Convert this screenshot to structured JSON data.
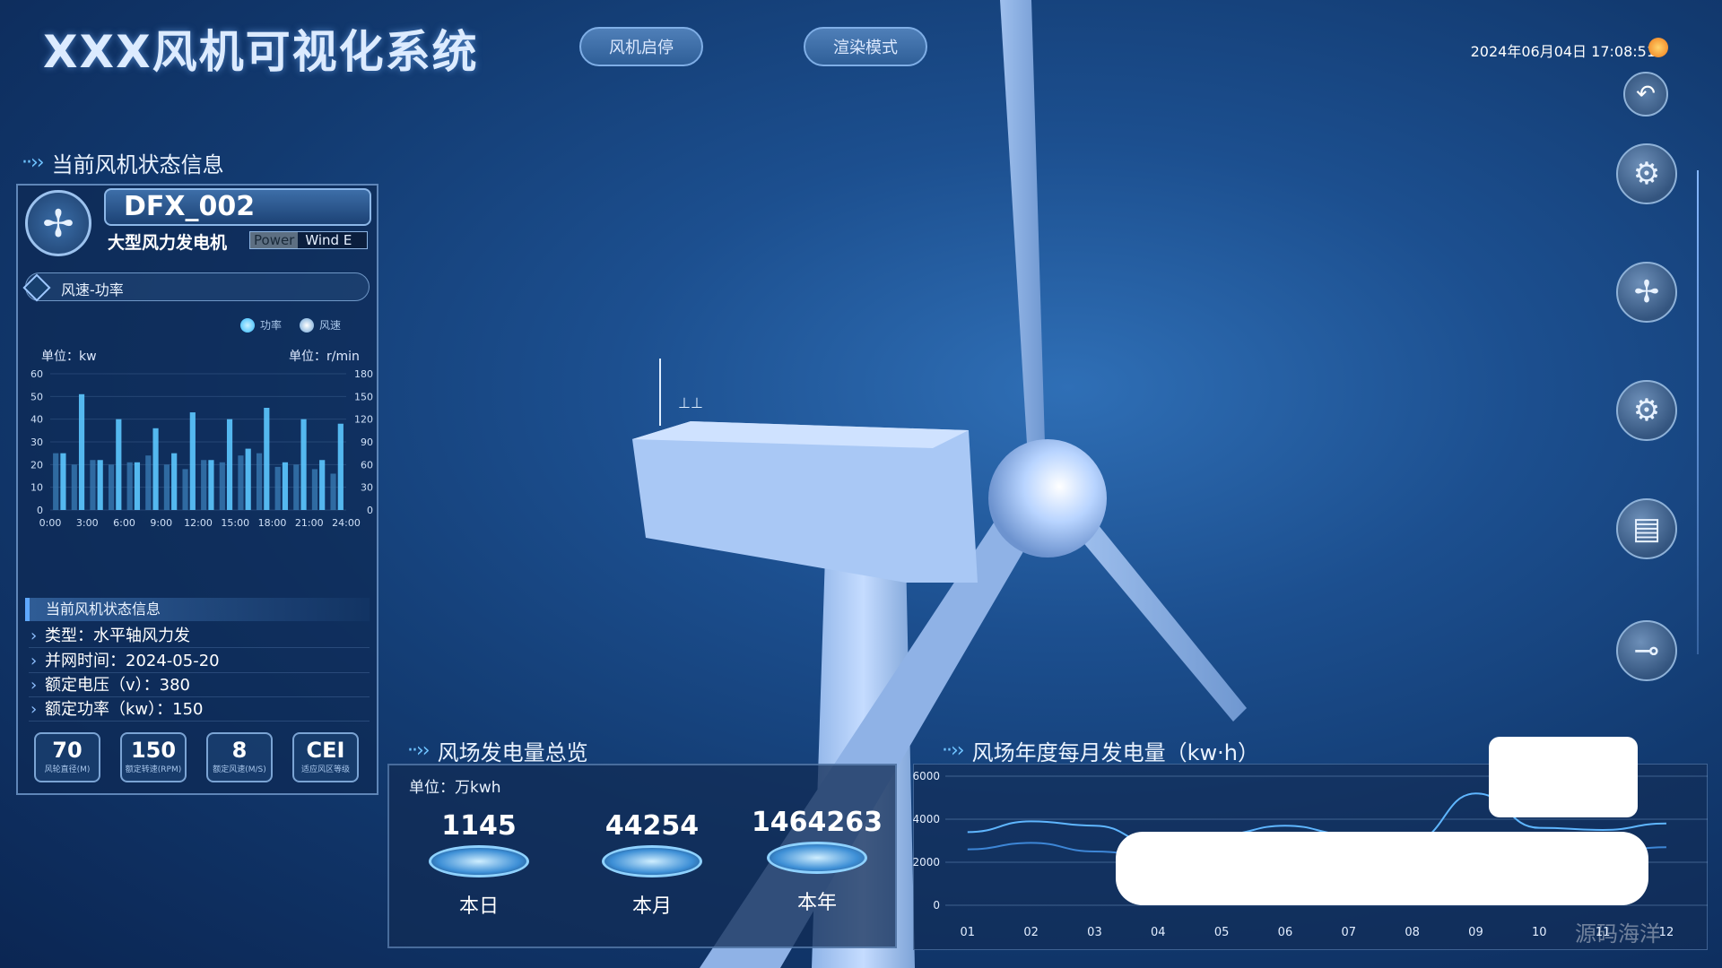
{
  "app": {
    "title": "XXX风机可视化系统",
    "buttons": [
      "风机启停",
      "渲染模式"
    ],
    "datetime": "2024年06月04日 17:08:51"
  },
  "status_section": {
    "title": "当前风机状态信息",
    "turbine_id": "DFX_002",
    "turbine_type": "大型风力发电机",
    "tag_power": "Power",
    "tag_wind": "Wind E",
    "chart_title": "风速-功率",
    "legend": [
      "功率",
      "风速"
    ],
    "unit_left": "单位：kw",
    "unit_right": "单位：r/min",
    "info_header": "当前风机状态信息",
    "info_rows": [
      "类型：水平轴风力发",
      "并网时间：2024-05-20",
      "额定电压（v）：380",
      "额定功率（kw）：150"
    ],
    "stats": [
      {
        "value": "70",
        "label": "风轮直径(M)"
      },
      {
        "value": "150",
        "label": "额定转速(RPM)"
      },
      {
        "value": "8",
        "label": "额定风速(M/S)"
      },
      {
        "value": "CEI",
        "label": "适应风区等级"
      }
    ]
  },
  "energy_section": {
    "title": "风场发电量总览",
    "unit": "单位：万kwh",
    "items": [
      {
        "value": "1145",
        "label": "本日"
      },
      {
        "value": "44254",
        "label": "本月"
      },
      {
        "value": "1464263",
        "label": "本年"
      }
    ]
  },
  "monthly_section": {
    "title": "风场年度每月发电量（kw·h）"
  },
  "right_icons": [
    "back-icon",
    "engine-icon",
    "fan-icon",
    "gear-icon",
    "generator-icon",
    "tool-icon"
  ],
  "watermark": "源码海洋",
  "colors": {
    "accent": "#6fc3ff",
    "panel_border": "#5f86b8",
    "bar_power": "#5cc8ff",
    "bar_wind": "#3b7fb8"
  },
  "chart_data": [
    {
      "type": "bar",
      "title": "风速-功率",
      "categories": [
        "0:00",
        "1:30",
        "3:00",
        "4:30",
        "6:00",
        "7:30",
        "9:00",
        "10:30",
        "12:00",
        "13:30",
        "15:00",
        "16:30",
        "18:00",
        "19:30",
        "21:00",
        "22:30"
      ],
      "x_ticks": [
        "0:00",
        "3:00",
        "6:00",
        "9:00",
        "12:00",
        "15:00",
        "18:00",
        "21:00",
        "24:00"
      ],
      "y_left": {
        "label": "单位：kw",
        "ticks": [
          0,
          10,
          20,
          30,
          40,
          50,
          60
        ],
        "lim": [
          0,
          60
        ]
      },
      "y_right": {
        "label": "单位：r/min",
        "ticks": [
          0,
          30,
          60,
          90,
          120,
          150,
          180
        ],
        "lim": [
          0,
          180
        ]
      },
      "series": [
        {
          "name": "功率",
          "axis": "left",
          "values": [
            25,
            51,
            22,
            40,
            21,
            36,
            25,
            43,
            22,
            40,
            27,
            45,
            21,
            40,
            22,
            38
          ]
        },
        {
          "name": "风速",
          "axis": "right",
          "values": [
            75,
            60,
            66,
            60,
            63,
            72,
            60,
            54,
            66,
            63,
            72,
            75,
            57,
            60,
            54,
            48
          ]
        }
      ],
      "grid": true,
      "legend": "top-right"
    },
    {
      "type": "line",
      "title": "风场年度每月发电量（kw·h）",
      "categories": [
        "01",
        "02",
        "03",
        "04",
        "05",
        "06",
        "07",
        "08",
        "09",
        "10",
        "11",
        "12"
      ],
      "y_ticks": [
        0,
        2000,
        4000,
        6000
      ],
      "ylim": [
        0,
        6000
      ],
      "series": [
        {
          "values": [
            3400,
            3900,
            3700,
            2800,
            3300,
            3700,
            3300,
            3000,
            5200,
            3600,
            3500,
            3800
          ]
        },
        {
          "values": [
            2600,
            2900,
            2500,
            2300,
            2400,
            2700,
            2600,
            2500,
            2800,
            2600,
            2500,
            2700
          ]
        }
      ],
      "grid": true
    }
  ]
}
